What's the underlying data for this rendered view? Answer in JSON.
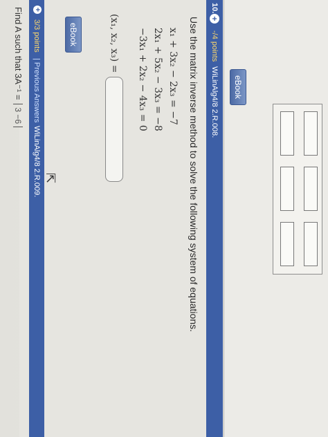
{
  "top": {
    "ebook_label": "eBook"
  },
  "question": {
    "number": "10.",
    "points": "-/4 points",
    "code": "WiLinAlg4/8 2.R.008.",
    "prompt": "Use the matrix inverse method to solve the following system of equations.",
    "equations": [
      "x₁ + 3x₂ − 2x₃ = −7",
      "2x₁ + 5x₂ − 3x₃ = −8",
      "−3x₁ + 2x₂ − 4x₃ = 0"
    ],
    "answer_label": "(x₁, x₂, x₃) =",
    "ebook_label": "eBook"
  },
  "next_question": {
    "points": "3/3 points",
    "previous_answers": "| Previous Answers",
    "code": "WiLinAlg4/8 2.R.009.",
    "prompt": "Find A such that 3A⁻¹ =",
    "matrix_hint": "3  −6"
  },
  "colors": {
    "header": "#3d5fa6",
    "points": "#ffd96b",
    "ebook": "#4c6aa5"
  }
}
